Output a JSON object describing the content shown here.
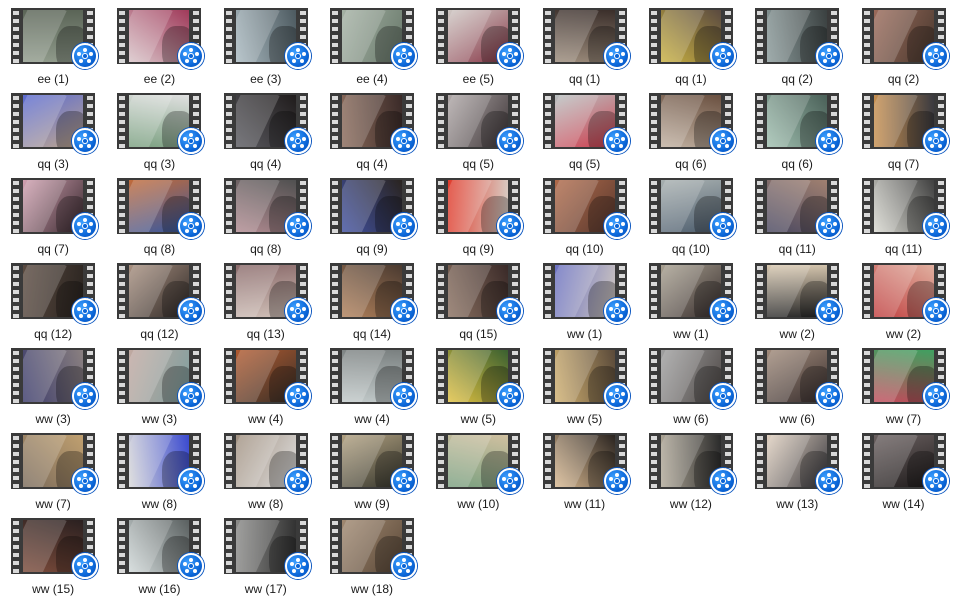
{
  "files": [
    {
      "name": "ee (1)",
      "colors": [
        "#8f9a8a",
        "#5a6456"
      ]
    },
    {
      "name": "ee (2)",
      "colors": [
        "#d8c4c8",
        "#a03a5a"
      ]
    },
    {
      "name": "ee (3)",
      "colors": [
        "#a9b9c0",
        "#4d5a60"
      ]
    },
    {
      "name": "ee (4)",
      "colors": [
        "#a4b1a4",
        "#6a7a6c"
      ]
    },
    {
      "name": "ee (5)",
      "colors": [
        "#cfc8c4",
        "#8a3a4a"
      ]
    },
    {
      "name": "qq (1)",
      "colors": [
        "#9a8a7a",
        "#3a2e2a"
      ]
    },
    {
      "name": "qq (1)",
      "colors": [
        "#c8b040",
        "#5a4a40"
      ]
    },
    {
      "name": "qq (2)",
      "colors": [
        "#8a9a9a",
        "#3a4040"
      ]
    },
    {
      "name": "qq (2)",
      "colors": [
        "#9a6a5a",
        "#4a3a30"
      ]
    },
    {
      "name": "qq (3)",
      "colors": [
        "#5a6ad0",
        "#c0a890"
      ]
    },
    {
      "name": "qq (3)",
      "colors": [
        "#7aa080",
        "#e0e0e0"
      ]
    },
    {
      "name": "qq (4)",
      "colors": [
        "#5a5a60",
        "#201c1c"
      ]
    },
    {
      "name": "qq (4)",
      "colors": [
        "#8a6a5a",
        "#3a2a28"
      ]
    },
    {
      "name": "qq (5)",
      "colors": [
        "#b0a8a8",
        "#40383a"
      ]
    },
    {
      "name": "qq (5)",
      "colors": [
        "#b8c0c0",
        "#d04050"
      ]
    },
    {
      "name": "qq (6)",
      "colors": [
        "#c0b0a0",
        "#6a5040"
      ]
    },
    {
      "name": "qq (6)",
      "colors": [
        "#a0c0b0",
        "#4a6058"
      ]
    },
    {
      "name": "qq (7)",
      "colors": [
        "#c89050",
        "#3a3a40"
      ]
    },
    {
      "name": "qq (7)",
      "colors": [
        "#d0a0b0",
        "#3a2a30"
      ]
    },
    {
      "name": "qq (8)",
      "colors": [
        "#c06a3a",
        "#3a5aa0"
      ]
    },
    {
      "name": "qq (8)",
      "colors": [
        "#b08a90",
        "#505050"
      ]
    },
    {
      "name": "qq (9)",
      "colors": [
        "#4050a0",
        "#2a2420"
      ]
    },
    {
      "name": "qq (9)",
      "colors": [
        "#e03a2a",
        "#d8d0c8"
      ]
    },
    {
      "name": "qq (10)",
      "colors": [
        "#b06a4a",
        "#5a3a30"
      ]
    },
    {
      "name": "qq (10)",
      "colors": [
        "#a8b0b0",
        "#506070"
      ]
    },
    {
      "name": "qq (11)",
      "colors": [
        "#4a4860",
        "#a08070"
      ]
    },
    {
      "name": "qq (11)",
      "colors": [
        "#d8d8d0",
        "#404040"
      ]
    },
    {
      "name": "qq (12)",
      "colors": [
        "#5a4a40",
        "#2a2420"
      ]
    },
    {
      "name": "qq (12)",
      "colors": [
        "#a89080",
        "#302a28"
      ]
    },
    {
      "name": "qq (13)",
      "colors": [
        "#8a6a6a",
        "#d0c0b8"
      ]
    },
    {
      "name": "qq (14)",
      "colors": [
        "#b0805a",
        "#4a3a30"
      ]
    },
    {
      "name": "qq (15)",
      "colors": [
        "#8a7060",
        "#3a2a28"
      ]
    },
    {
      "name": "ww (1)",
      "colors": [
        "#6a70c0",
        "#d0c8c0"
      ]
    },
    {
      "name": "ww (1)",
      "colors": [
        "#a8a090",
        "#3a3030"
      ]
    },
    {
      "name": "ww (2)",
      "colors": [
        "#d8c8b0",
        "#2a2a2a"
      ]
    },
    {
      "name": "ww (2)",
      "colors": [
        "#c04040",
        "#e0b0a0"
      ]
    },
    {
      "name": "ww (3)",
      "colors": [
        "#3a3a6a",
        "#8a8080"
      ]
    },
    {
      "name": "ww (3)",
      "colors": [
        "#c0a8a0",
        "#80a0a0"
      ]
    },
    {
      "name": "ww (4)",
      "colors": [
        "#b05a30",
        "#3a3028"
      ]
    },
    {
      "name": "ww (4)",
      "colors": [
        "#c0c8c8",
        "#7a8080"
      ]
    },
    {
      "name": "ww (5)",
      "colors": [
        "#e0c040",
        "#3a6030"
      ]
    },
    {
      "name": "ww (5)",
      "colors": [
        "#d0b070",
        "#5a4a3a"
      ]
    },
    {
      "name": "ww (6)",
      "colors": [
        "#a0a0a0",
        "#504a48"
      ]
    },
    {
      "name": "ww (6)",
      "colors": [
        "#a08a7a",
        "#3a3030"
      ]
    },
    {
      "name": "ww (7)",
      "colors": [
        "#c04a5a",
        "#40a060"
      ]
    },
    {
      "name": "ww (7)",
      "colors": [
        "#7a6a5a",
        "#c0a070"
      ]
    },
    {
      "name": "ww (8)",
      "colors": [
        "#d8d8d8",
        "#3a4ad0"
      ]
    },
    {
      "name": "ww (8)",
      "colors": [
        "#a09080",
        "#e0e0e0"
      ]
    },
    {
      "name": "ww (9)",
      "colors": [
        "#b0a080",
        "#3a3a30"
      ]
    },
    {
      "name": "ww (10)",
      "colors": [
        "#7aa080",
        "#d0c0a0"
      ]
    },
    {
      "name": "ww (11)",
      "colors": [
        "#d8b890",
        "#2a2420"
      ]
    },
    {
      "name": "ww (12)",
      "colors": [
        "#b0a898",
        "#2a2a2a"
      ]
    },
    {
      "name": "ww (13)",
      "colors": [
        "#e0d0c0",
        "#3a3a40"
      ]
    },
    {
      "name": "ww (14)",
      "colors": [
        "#6a6060",
        "#201c1c"
      ]
    },
    {
      "name": "ww (15)",
      "colors": [
        "#7a4a3a",
        "#2a2020"
      ]
    },
    {
      "name": "ww (16)",
      "colors": [
        "#d0d8d8",
        "#5a6060"
      ]
    },
    {
      "name": "ww (17)",
      "colors": [
        "#8a8a88",
        "#303030"
      ]
    },
    {
      "name": "ww (18)",
      "colors": [
        "#a08870",
        "#5a4838"
      ]
    }
  ],
  "icons": {
    "badge": "video-file-icon"
  }
}
